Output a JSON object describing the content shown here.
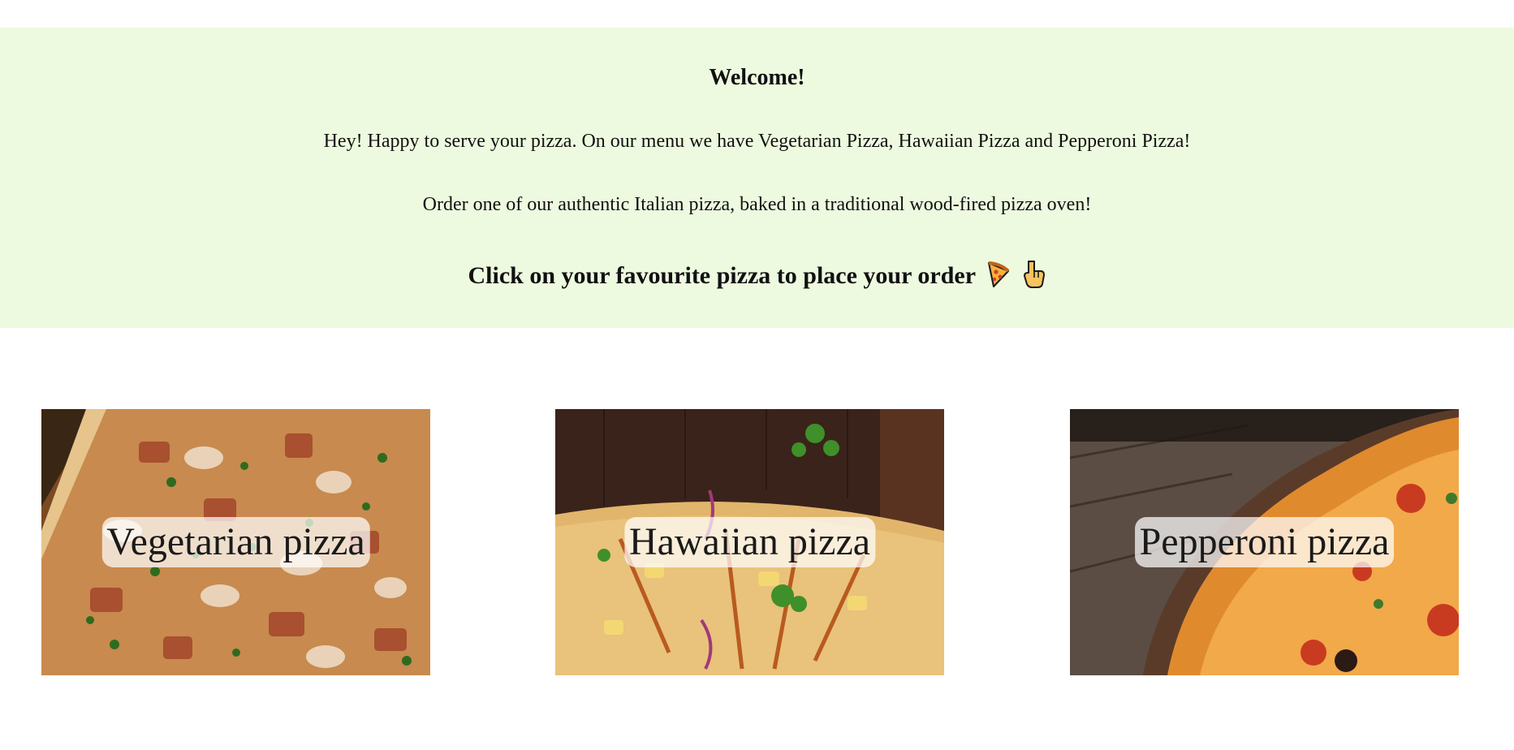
{
  "banner": {
    "heading": "Welcome!",
    "intro": "Hey! Happy to serve your pizza. On our menu we have Vegetarian Pizza, Hawaiian Pizza and Pepperoni Pizza!",
    "tagline": "Order one of our authentic Italian pizza, baked in a traditional wood-fired pizza oven!",
    "cta": "Click on your favourite pizza to place your order",
    "cta_icons": [
      "pizza-slice-icon",
      "pointing-down-icon"
    ],
    "background_color": "#edfadf"
  },
  "pizzas": [
    {
      "label": "Vegetarian pizza"
    },
    {
      "label": "Hawaiian pizza"
    },
    {
      "label": "Pepperoni pizza"
    }
  ]
}
